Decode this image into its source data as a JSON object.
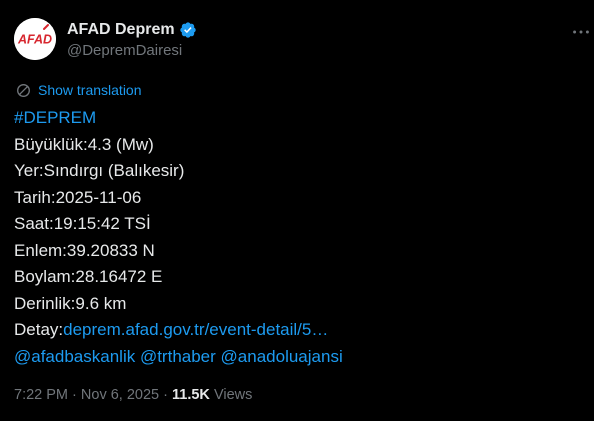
{
  "author": {
    "display_name": "AFAD Deprem",
    "handle": "@DepremDairesi",
    "avatar_text": "AFAD",
    "verified": true
  },
  "translate": {
    "label": "Show translation",
    "icon": "translate-icon"
  },
  "post": {
    "hashtag": "#DEPREM",
    "lines": [
      "Büyüklük:4.3 (Mw)",
      "Yer:Sındırgı (Balıkesir)",
      "Tarih:2025-11-06",
      "Saat:19:15:42 TSİ",
      "Enlem:39.20833 N",
      "Boylam:28.16472 E",
      "Derinlik:9.6 km"
    ],
    "detail_label": "Detay:",
    "detail_link": "deprem.afad.gov.tr/event-detail/5…",
    "mentions": [
      "@afadbaskanlik",
      "@trthaber",
      "@anadoluajansi"
    ]
  },
  "meta": {
    "time": "7:22 PM",
    "separator": "·",
    "date": "Nov 6, 2025",
    "views_count": "11.5K",
    "views_label": "Views"
  },
  "colors": {
    "background": "#000000",
    "text": "#e7e9ea",
    "secondary": "#71767b",
    "accent": "#1d9bf0",
    "afad_red": "#d7262e"
  }
}
